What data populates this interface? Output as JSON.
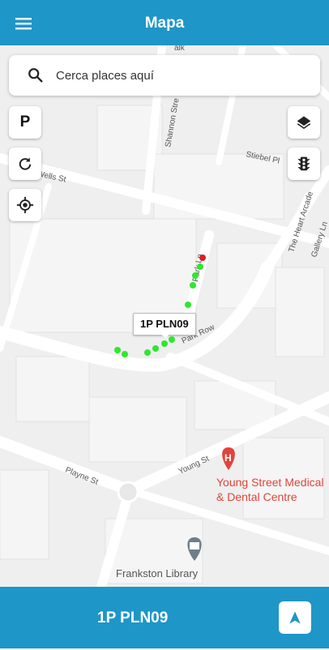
{
  "app_bar": {
    "title": "Mapa"
  },
  "search": {
    "placeholder": "Cerca places aquí"
  },
  "controls": {
    "parking_label": "P"
  },
  "map": {
    "streets": {
      "wells_st": "Wells St",
      "shannon_st": "Shannon Stre",
      "stiebel_pl": "Stiebel Pl",
      "the_heart_arcade": "The Heart Arcade",
      "gallery_ln": "Gallery Ln",
      "park_ln": "Park Ln",
      "park_row": "Park Row",
      "young_st": "Young St",
      "playne_st": "Playne St",
      "top_street": "alk"
    },
    "pois": {
      "young_street_medical_line1": "Young Street Medical",
      "young_street_medical_line2": "& Dental Centre",
      "frankston_library": "Frankston Library"
    },
    "marker_label": "1P PLN09",
    "colors": {
      "track_point": "#2ee82e",
      "end_point": "#e02020",
      "poi_medical": "#e0453a",
      "poi_library": "#6f7f8a"
    }
  },
  "bottom_bar": {
    "label": "1P PLN09"
  },
  "colors": {
    "primary": "#1e96c8"
  }
}
